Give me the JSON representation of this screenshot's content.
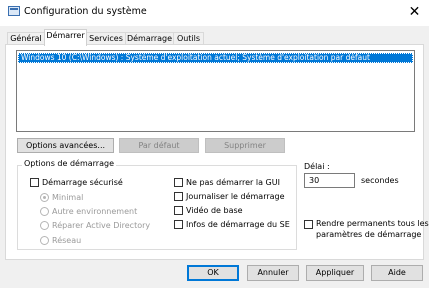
{
  "window": {
    "title": "Configuration du système",
    "close_glyph": "✕"
  },
  "tabs": [
    {
      "label": "Général"
    },
    {
      "label": "Démarrer"
    },
    {
      "label": "Services"
    },
    {
      "label": "Démarrage"
    },
    {
      "label": "Outils"
    }
  ],
  "boot_list": {
    "entries": [
      "Windows 10 (C:\\Windows) : Système d'exploitation actuel; Système d'exploitation par défaut"
    ]
  },
  "buttons": {
    "advanced": "Options avancées...",
    "set_default": "Par défaut",
    "delete": "Supprimer"
  },
  "boot_options": {
    "group_label": "Options de démarrage",
    "safe_boot": "Démarrage sécurisé",
    "radios": [
      "Minimal",
      "Autre environnement",
      "Réparer Active Directory",
      "Réseau"
    ],
    "no_gui": "Ne pas démarrer la GUI",
    "boot_log": "Journaliser le démarrage",
    "base_video": "Vidéo de base",
    "os_info": "Infos de démarrage du SE"
  },
  "timeout": {
    "label": "Délai :",
    "value": "30",
    "unit": "secondes"
  },
  "permanent": {
    "label_line1": "Rendre permanents tous les",
    "label_line2": "paramètres de démarrage"
  },
  "footer": {
    "ok": "OK",
    "cancel": "Annuler",
    "apply": "Appliquer",
    "help": "Aide"
  },
  "colors": {
    "selection": "#0078d7",
    "default_button_border": "#0078d7"
  }
}
